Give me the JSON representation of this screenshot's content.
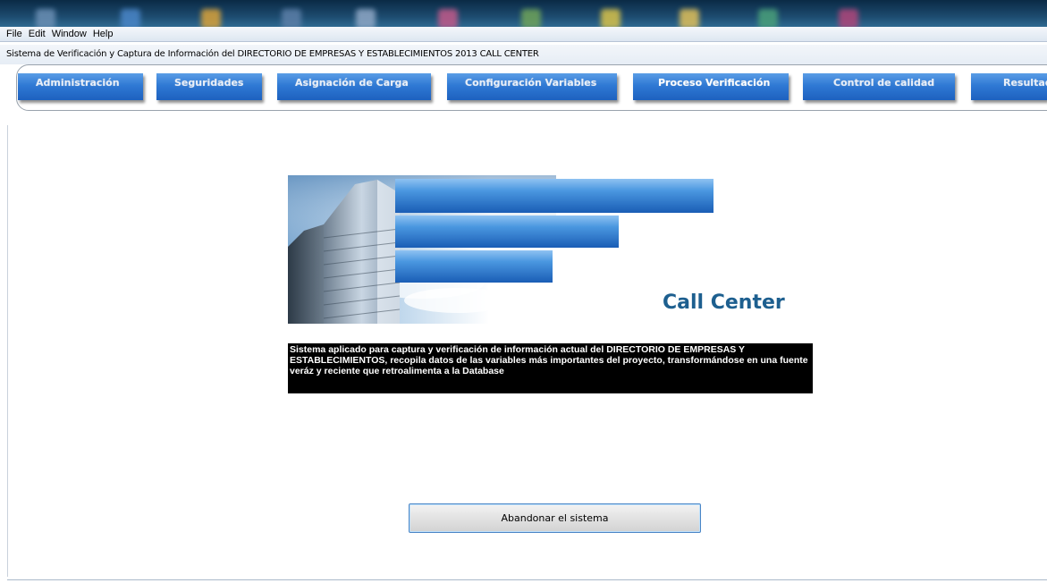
{
  "menu": {
    "items": [
      "File",
      "Edit",
      "Window",
      "Help"
    ]
  },
  "window": {
    "title": "Sistema de Verificación y Captura de Información del DIRECTORIO DE EMPRESAS Y ESTABLECIMIENTOS 2013    CALL CENTER"
  },
  "nav": {
    "tabs": [
      {
        "label": "Administración"
      },
      {
        "label": "Seguridades"
      },
      {
        "label": "Asignación de Carga"
      },
      {
        "label": "Configuración Variables"
      },
      {
        "label": "Proceso Verificación"
      },
      {
        "label": "Control de calidad"
      },
      {
        "label": "Resultados"
      }
    ]
  },
  "main": {
    "brand": "Call Center",
    "description": "Sistema aplicado para captura y verificación de información actual del DIRECTORIO DE EMPRESAS Y ESTABLECIMIENTOS, recopila datos de las variables más importantes del proyecto, transformándose en una fuente veráz y reciente que retroalimenta a la Database",
    "exit_button": "Abandonar el sistema"
  },
  "colors": {
    "nav_button": "#2f79d4",
    "brand_text": "#1d5f8f",
    "desc_background": "#000000"
  }
}
